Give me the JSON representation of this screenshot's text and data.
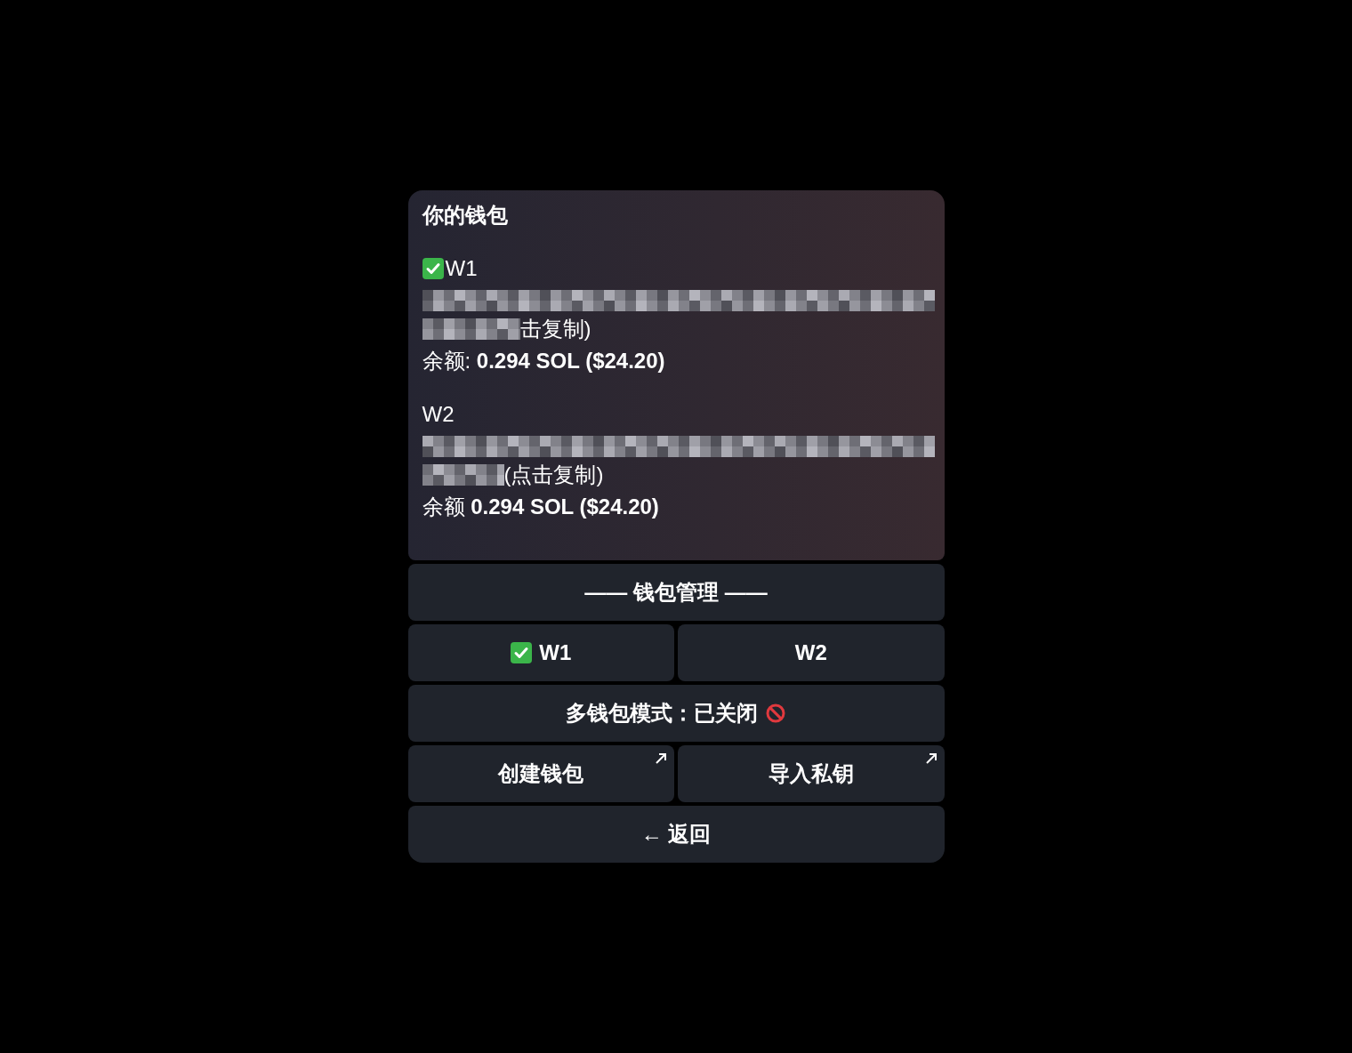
{
  "message": {
    "title": "你的钱包",
    "wallets": [
      {
        "name": "W1",
        "selected": true,
        "copy_hint": "击复制)",
        "balance": "余额: **0.294 SOL ($24.20)**"
      },
      {
        "name": "W2",
        "selected": false,
        "copy_hint": "(点击复制)",
        "balance": "余额 **0.294 SOL ($24.20)**"
      }
    ]
  },
  "keyboard": {
    "header": "—— 钱包管理 ——",
    "wallet_buttons": [
      {
        "label": "W1",
        "selected": true
      },
      {
        "label": "W2",
        "selected": false
      }
    ],
    "multi_wallet": {
      "label": "多钱包模式：已关闭",
      "on": false
    },
    "actions": [
      {
        "label": "创建钱包"
      },
      {
        "label": "导入私钥"
      }
    ],
    "back": {
      "label": "← 返回"
    }
  }
}
